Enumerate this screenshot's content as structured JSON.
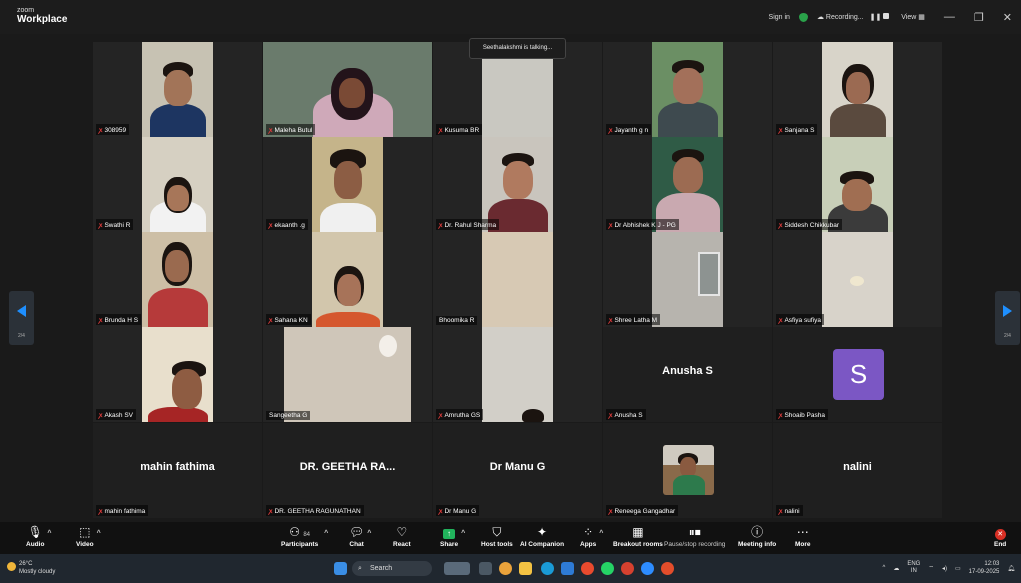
{
  "titlebar": {
    "brand_small": "zoom",
    "brand": "Workplace",
    "sign_in": "Sign in",
    "recording": "Recording...",
    "view": "View"
  },
  "toast": "Seethalakshmi is talking...",
  "nav": {
    "left_page": "2/4",
    "right_page": "2/4"
  },
  "participants": [
    {
      "name": "308959"
    },
    {
      "name": "Maleha Butul"
    },
    {
      "name": "Kusuma BR"
    },
    {
      "name": "Jayanth g n"
    },
    {
      "name": "Sanjana S"
    },
    {
      "name": "Swathi R"
    },
    {
      "name": "ekaanth .g"
    },
    {
      "name": "Dr. Rahul Sharma"
    },
    {
      "name": "Dr Abhishek K J - PG"
    },
    {
      "name": "Siddesh Chikkubar"
    },
    {
      "name": "Brunda H S"
    },
    {
      "name": "Sahana KN"
    },
    {
      "name": "Bhoomika R"
    },
    {
      "name": "Shree Latha M"
    },
    {
      "name": "Asfiya sufiya"
    },
    {
      "name": "Akash SV"
    },
    {
      "name": "Sangeetha G"
    },
    {
      "name": "Amrutha GS"
    },
    {
      "name": "Anusha S",
      "display": "Anusha S"
    },
    {
      "name": "Shoaib Pasha",
      "avatar_letter": "S"
    },
    {
      "name": "mahin fathima",
      "display": "mahin fathima"
    },
    {
      "name": "DR. GEETHA RAGUNATHAN",
      "display": "DR. GEETHA RA..."
    },
    {
      "name": "Dr Manu G",
      "display": "Dr Manu G"
    },
    {
      "name": "Reneega Gangadhar"
    },
    {
      "name": "nalini",
      "display": "nalini"
    }
  ],
  "toolbar": {
    "audio": "Audio",
    "video": "Video",
    "participants": "Participants",
    "participant_count": "84",
    "chat": "Chat",
    "react": "React",
    "share": "Share",
    "host_tools": "Host tools",
    "ai_companion": "AI Companion",
    "apps": "Apps",
    "breakout_rooms": "Breakout rooms",
    "pause_recording": "Pause/stop recording",
    "meeting_info": "Meeting info",
    "more": "More",
    "end": "End"
  },
  "taskbar": {
    "temp": "26°C",
    "weather": "Mostly cloudy",
    "search": "Search",
    "lang1": "ENG",
    "lang2": "IN",
    "time": "12:03",
    "date": "17-09-2025"
  },
  "colors": {
    "accent": "#0e72ed",
    "mute_red": "#e03b3b",
    "avatar_purple": "#7b57c4",
    "share_green": "#21b35c"
  }
}
